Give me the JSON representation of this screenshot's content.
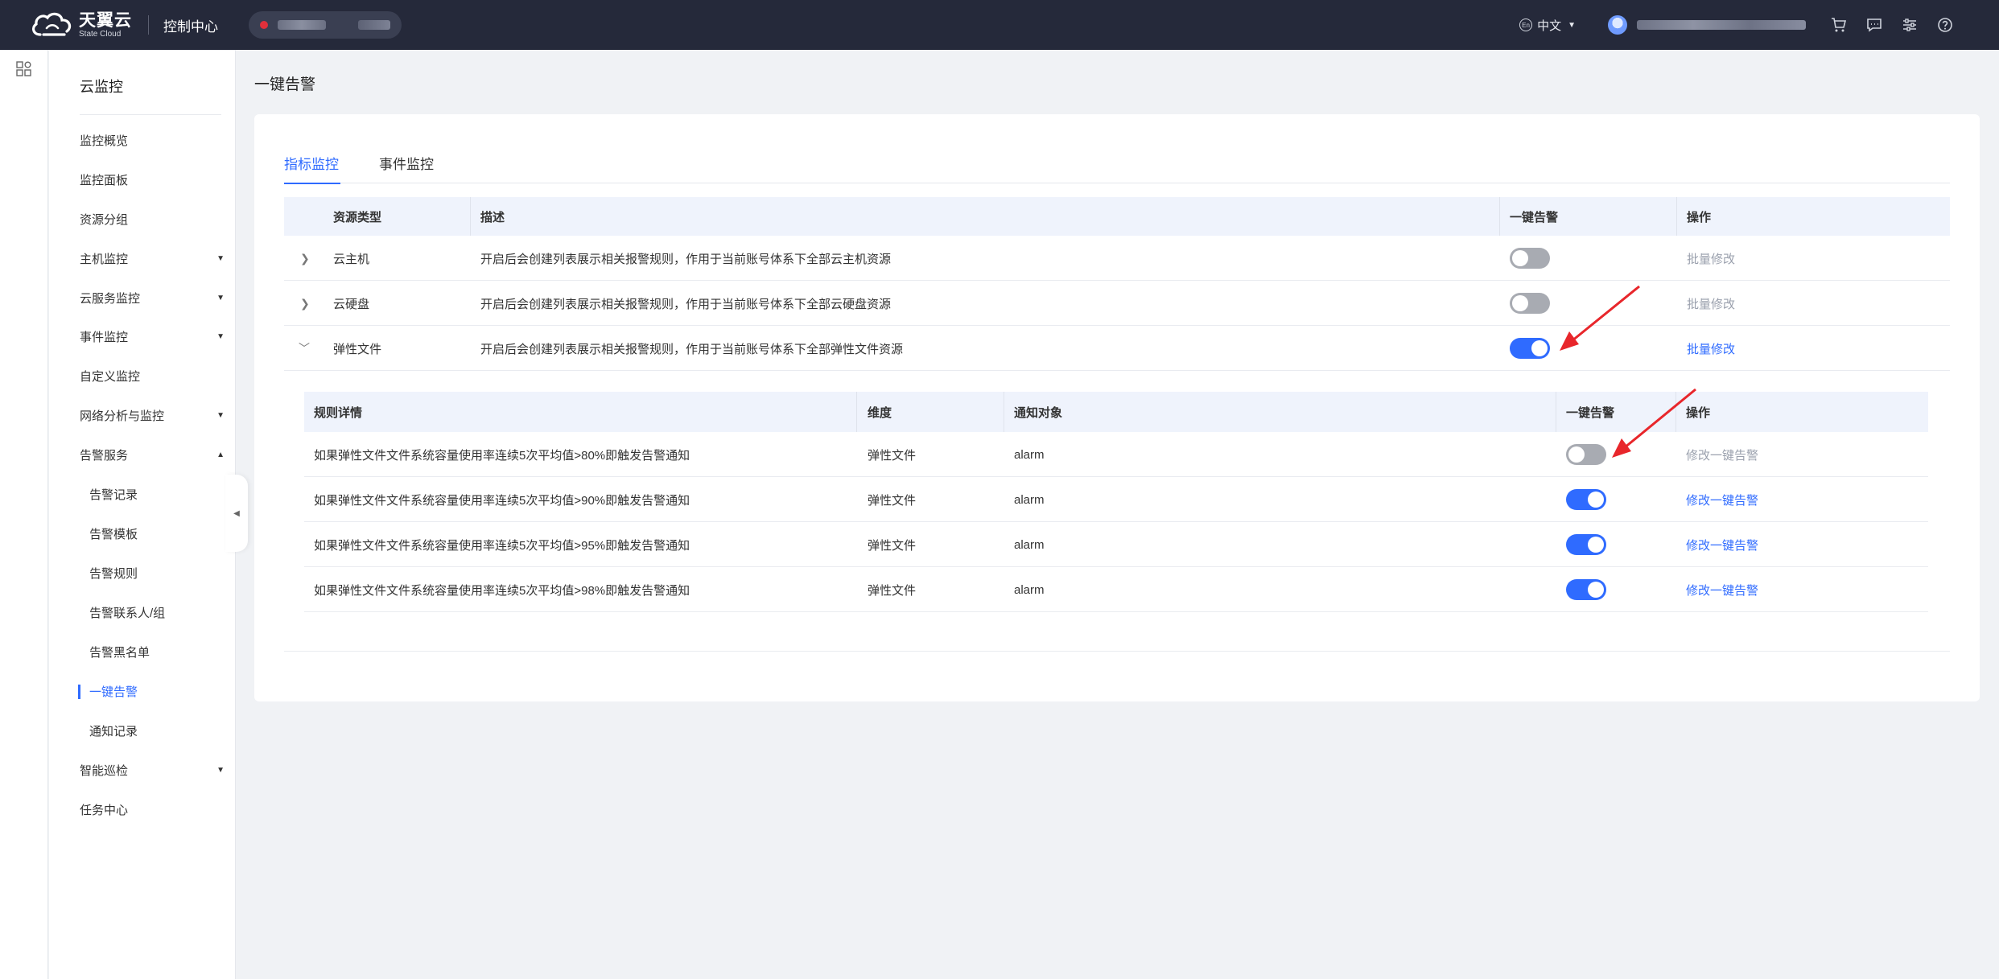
{
  "topbar": {
    "logo_cn": "天翼云",
    "logo_en": "State Cloud",
    "console_label": "控制中心",
    "language": "中文",
    "icons": [
      "cart-icon",
      "message-icon",
      "settings-sliders-icon",
      "help-icon"
    ]
  },
  "sidebar": {
    "title": "云监控",
    "items": [
      {
        "label": "监控概览",
        "expandable": false
      },
      {
        "label": "监控面板",
        "expandable": false
      },
      {
        "label": "资源分组",
        "expandable": false
      },
      {
        "label": "主机监控",
        "expandable": true,
        "expanded": false
      },
      {
        "label": "云服务监控",
        "expandable": true,
        "expanded": false
      },
      {
        "label": "事件监控",
        "expandable": true,
        "expanded": false
      },
      {
        "label": "自定义监控",
        "expandable": false
      },
      {
        "label": "网络分析与监控",
        "expandable": true,
        "expanded": false
      },
      {
        "label": "告警服务",
        "expandable": true,
        "expanded": true
      },
      {
        "label": "智能巡检",
        "expandable": true,
        "expanded": false
      },
      {
        "label": "任务中心",
        "expandable": false
      }
    ],
    "alarm_subitems": [
      {
        "label": "告警记录",
        "active": false
      },
      {
        "label": "告警模板",
        "active": false
      },
      {
        "label": "告警规则",
        "active": false
      },
      {
        "label": "告警联系人/组",
        "active": false
      },
      {
        "label": "告警黑名单",
        "active": false
      },
      {
        "label": "一键告警",
        "active": true
      },
      {
        "label": "通知记录",
        "active": false
      }
    ]
  },
  "page": {
    "title": "一键告警",
    "tabs": [
      {
        "label": "指标监控",
        "active": true
      },
      {
        "label": "事件监控",
        "active": false
      }
    ]
  },
  "resource_table": {
    "columns": [
      "资源类型",
      "描述",
      "一键告警",
      "操作"
    ],
    "rows": [
      {
        "type": "云主机",
        "desc": "开启后会创建列表展示相关报警规则，作用于当前账号体系下全部云主机资源",
        "enabled": false,
        "expanded": false,
        "action": "批量修改",
        "action_enabled": false
      },
      {
        "type": "云硬盘",
        "desc": "开启后会创建列表展示相关报警规则，作用于当前账号体系下全部云硬盘资源",
        "enabled": false,
        "expanded": false,
        "action": "批量修改",
        "action_enabled": false
      },
      {
        "type": "弹性文件",
        "desc": "开启后会创建列表展示相关报警规则，作用于当前账号体系下全部弹性文件资源",
        "enabled": true,
        "expanded": true,
        "action": "批量修改",
        "action_enabled": true
      }
    ]
  },
  "rule_table": {
    "columns": [
      "规则详情",
      "维度",
      "通知对象",
      "一键告警",
      "操作"
    ],
    "rows": [
      {
        "detail": "如果弹性文件文件系统容量使用率连续5次平均值>80%即触发告警通知",
        "dimension": "弹性文件",
        "notify": "alarm",
        "enabled": false,
        "action": "修改一键告警",
        "action_enabled": false
      },
      {
        "detail": "如果弹性文件文件系统容量使用率连续5次平均值>90%即触发告警通知",
        "dimension": "弹性文件",
        "notify": "alarm",
        "enabled": true,
        "action": "修改一键告警",
        "action_enabled": true
      },
      {
        "detail": "如果弹性文件文件系统容量使用率连续5次平均值>95%即触发告警通知",
        "dimension": "弹性文件",
        "notify": "alarm",
        "enabled": true,
        "action": "修改一键告警",
        "action_enabled": true
      },
      {
        "detail": "如果弹性文件文件系统容量使用率连续5次平均值>98%即触发告警通知",
        "dimension": "弹性文件",
        "notify": "alarm",
        "enabled": true,
        "action": "修改一键告警",
        "action_enabled": true
      }
    ]
  },
  "colors": {
    "accent": "#2f6bff",
    "topbar": "#25293a",
    "toggle_off": "#a8abb2",
    "annotation_arrow": "#e8262b"
  }
}
